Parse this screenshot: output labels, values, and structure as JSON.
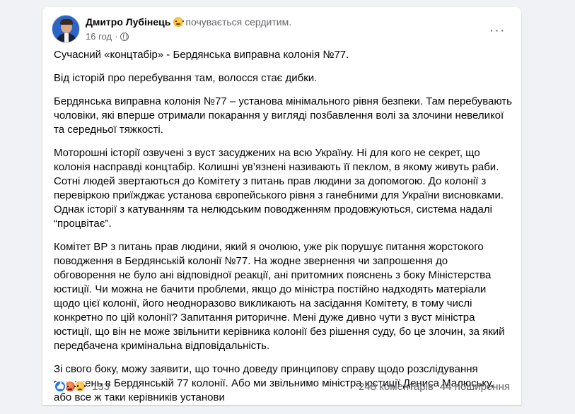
{
  "post": {
    "author": "Дмитро Лубінець",
    "feeling": "почувається сердитим.",
    "time": "16 год",
    "dot": "·",
    "more": "···",
    "paragraphs": [
      "Сучасний «концтабір» - Бердянська виправна колонія №77.",
      "Від історій про перебування там,  волосся стає дибки.",
      "Бердянська виправна колонія №77 – установа мінімального рівня безпеки. Там перебувають чоловіки, які вперше отримали покарання у вигляді позбавлення волі за злочини невеликої та середньої тяжкості.",
      "Моторошні історії озвучені з вуст засуджених на всю Україну. Ні для кого не секрет, що колонія насправді концтабір. Колишні ув’язнені називають її пеклом, в якому живуть раби. Сотні людей звертаються до Комітету з питань прав людини за допомогою. До колонії з перевіркою приїжджає установа європейського рівня з ганебними для України висновками. Однак історії з катуванням та нелюдським поводженням продовжуються, система надалі “процвітає”.",
      "Комітет ВР з питань прав людини, який я очолюю, уже рік порушує питання жорстокого поводження в Бердянській колонії №77. На жодне звернення чи запрошення до обговорення не було ані відповідної реакції, ані притомних пояснень з боку Міністерства юстиції. Чи можна не бачити проблеми, якщо до міністра постійно надходять матеріали щодо цієї колонії, його неодноразово викликають на засідання Комітету, в тому числі конкретно по цій колонії? Запитання риторичне. Мені дуже дивно чути з вуст міністра юстиції, що він не може звільнити керівника колонії без рішення суду, бо це злочин, за який передбачена кримінальна відповідальність.",
      "Зі свого боку, можу заявити, що точно доведу принципову справу щодо розслідування порушень в Бердянській 77 колонії. Або ми звільнимо міністра юстиції Дениса Малюську, або все ж таки керівників установи"
    ],
    "reactions": {
      "icons": [
        "like-icon",
        "angry-icon",
        "sad-icon"
      ],
      "count": "133"
    },
    "comments": "248 коментарів",
    "shares": "44 поширення"
  }
}
